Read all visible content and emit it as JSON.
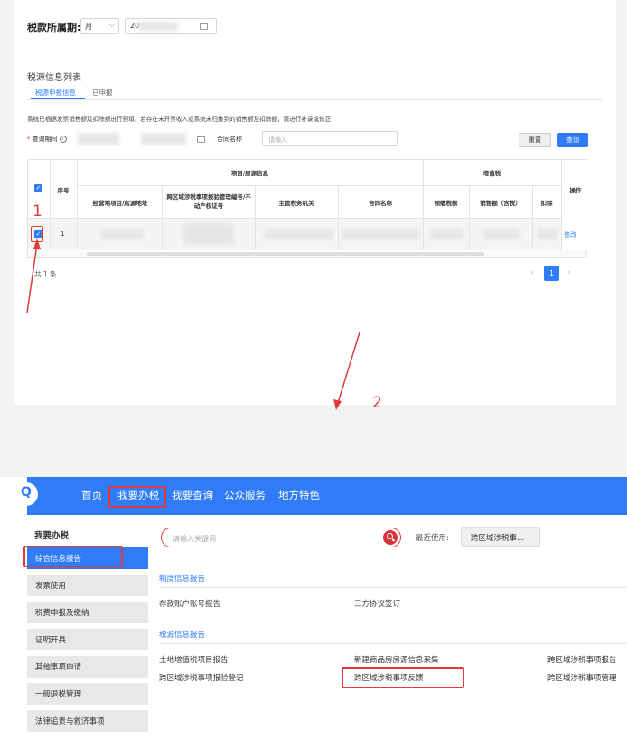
{
  "top": {
    "period_label": "税款所属期:",
    "month_value": "月",
    "date_value": "20",
    "section_title": "税源信息列表",
    "tabs": [
      {
        "label": "税源申报信息",
        "active": true
      },
      {
        "label": "已申报",
        "active": false
      }
    ],
    "notice": "系统已根据发票销售额及扣除额进行预填，若存在未开票收入或系统未归集到的销售额及扣除额，请进行补录或修正!",
    "query_label": "查询期间",
    "contract_label": "合同名称",
    "contract_placeholder": "请输入",
    "reset_label": "重置",
    "query_label_btn": "查询",
    "table": {
      "col_seq": "序号",
      "group_project": "项目/房源信息",
      "group_vat": "增值税",
      "col_op": "操作",
      "sub_headers": [
        "经营地项目/房源地址",
        "跨区域涉税事项报验管理编号/不动产权证号",
        "主管税务机关",
        "合同名称",
        "预缴税额",
        "销售额（含税）",
        "扣除"
      ],
      "rows": [
        {
          "seq": "1",
          "op": "修改"
        }
      ]
    },
    "total": "共 1 条",
    "current_page": "1",
    "pg_prev": "‹",
    "pg_next": "›"
  },
  "annotations": {
    "step1": "1",
    "step2": "2"
  },
  "bottom": {
    "nav": [
      "首页",
      "我要办税",
      "我要查询",
      "公众服务",
      "地方特色"
    ],
    "logo_glyph": "Q",
    "sidebar_title": "我要办税",
    "sidebar_items": [
      {
        "label": "综合信息报告",
        "active": true
      },
      {
        "label": "发票使用",
        "active": false
      },
      {
        "label": "税费申报及缴纳",
        "active": false
      },
      {
        "label": "证明开具",
        "active": false
      },
      {
        "label": "其他事项申请",
        "active": false
      },
      {
        "label": "一般退税管理",
        "active": false
      },
      {
        "label": "法律追责与救济事项",
        "active": false
      }
    ],
    "search_placeholder": "请输入关键词",
    "recent_label": "最近使用:",
    "recent_chip": "跨区域涉税事...",
    "group1_title": "制度信息报告",
    "group1_items": [
      "存款账户账号报告",
      "三方协议签订"
    ],
    "group2_title": "税源信息报告",
    "group2_items": [
      "土地增值税项目报告",
      "新建商品房房源信息采集",
      "跨区域涉税事项报告",
      "跨区域涉税事项报验登记",
      "跨区域涉税事项反馈",
      "跨区域涉税事项管理"
    ]
  },
  "colors": {
    "accent": "#2f7cf6",
    "highlight": "#e23a3a"
  }
}
